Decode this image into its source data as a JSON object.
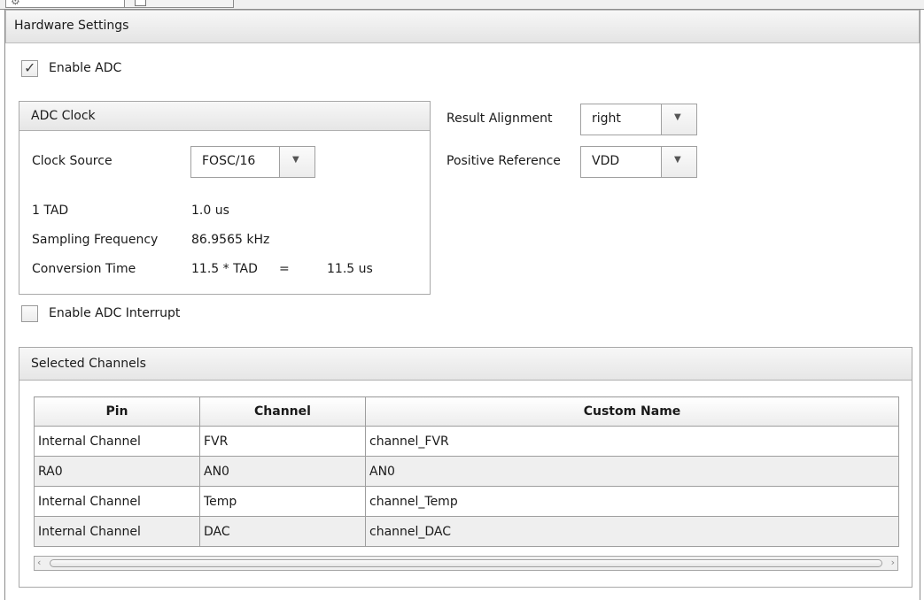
{
  "hardware_settings": {
    "title": "Hardware Settings",
    "enable_adc": {
      "label": "Enable ADC",
      "checked": true
    },
    "adc_clock": {
      "title": "ADC Clock",
      "clock_source_label": "Clock Source",
      "clock_source_value": "FOSC/16",
      "tad_label": "1 TAD",
      "tad_value": "1.0 us",
      "sampling_label": "Sampling Frequency",
      "sampling_value": "86.9565 kHz",
      "conversion_label": "Conversion Time",
      "conversion_expr": "11.5 * TAD",
      "conversion_eq": "=",
      "conversion_value": "11.5 us"
    },
    "result_alignment": {
      "label": "Result Alignment",
      "value": "right"
    },
    "positive_reference": {
      "label": "Positive Reference",
      "value": "VDD"
    },
    "enable_interrupt": {
      "label": "Enable ADC Interrupt",
      "checked": false
    }
  },
  "selected_channels": {
    "title": "Selected Channels",
    "columns": [
      "Pin",
      "Channel",
      "Custom Name"
    ],
    "rows": [
      [
        "Internal Channel",
        "FVR",
        "channel_FVR"
      ],
      [
        "RA0",
        "AN0",
        "AN0"
      ],
      [
        "Internal Channel",
        "Temp",
        "channel_Temp"
      ],
      [
        "Internal Channel",
        "DAC",
        "channel_DAC"
      ]
    ]
  },
  "icons": {
    "checkmark": "check-icon",
    "dropdown": "dropdown-arrow-icon"
  }
}
